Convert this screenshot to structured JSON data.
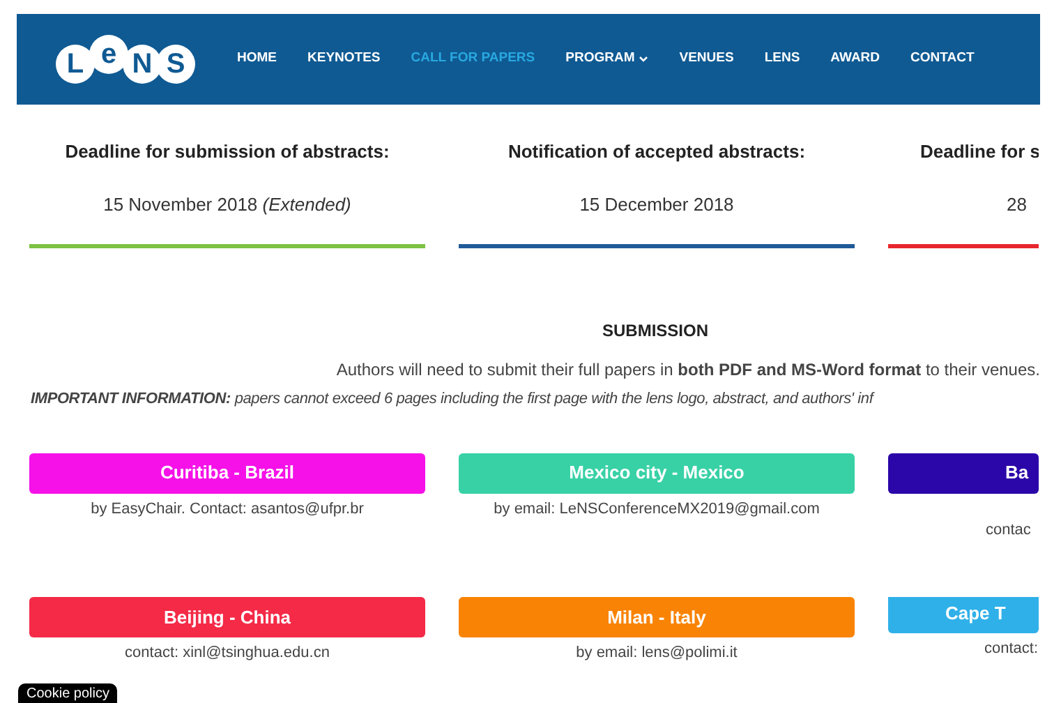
{
  "logo": {
    "letters": [
      "L",
      "e",
      "N",
      "S"
    ]
  },
  "nav": [
    {
      "label": "HOME",
      "selected": false,
      "dropdown": false
    },
    {
      "label": "KEYNOTES",
      "selected": false,
      "dropdown": false
    },
    {
      "label": "CALL FOR PAPERS",
      "selected": true,
      "dropdown": false
    },
    {
      "label": "PROGRAM",
      "selected": false,
      "dropdown": true
    },
    {
      "label": "VENUES",
      "selected": false,
      "dropdown": false
    },
    {
      "label": "LENS",
      "selected": false,
      "dropdown": false
    },
    {
      "label": "AWARD",
      "selected": false,
      "dropdown": false
    },
    {
      "label": "CONTACT",
      "selected": false,
      "dropdown": false
    }
  ],
  "deadlines": [
    {
      "title": "Deadline for submission of abstracts:",
      "date": "15 November 2018",
      "note": "(Extended)",
      "color": "#7dc242"
    },
    {
      "title": "Notification of accepted abstracts:",
      "date": "15 December 2018",
      "color": "#1f5a99"
    },
    {
      "title": "Deadline for s",
      "date": "28",
      "color": "#e8262d"
    }
  ],
  "submission": {
    "heading": "SUBMISSION",
    "text": "Authors will need to submit their full papers in **both PDF and MS-Word format** to their venues.",
    "important": "**IMPORTANT INFORMATION:** papers cannot exceed 6 pages including the first page with the lens logo, abstract, and authors' inf"
  },
  "venues": [
    {
      "name": "Curitiba - Brazil",
      "color": "#f511e8",
      "info": "by EasyChair. Contact: asantos@ufpr.br"
    },
    {
      "name": "Mexico city - Mexico",
      "color": "#38d1a6",
      "info": "by email: LeNSConferenceMX2019@gmail.com"
    },
    {
      "name": "Ba",
      "color": "#2b06a8",
      "info": "contac"
    },
    {
      "name": "Beijing - China",
      "color": "#f42a47",
      "info": "contact: xinl@tsinghua.edu.cn"
    },
    {
      "name": "Milan - Italy",
      "color": "#f98305",
      "info": "by email: lens@polimi.it"
    },
    {
      "name": "Cape T",
      "color": "#2fb0e8",
      "info": "contact:"
    }
  ],
  "cookie": "Cookie policy"
}
